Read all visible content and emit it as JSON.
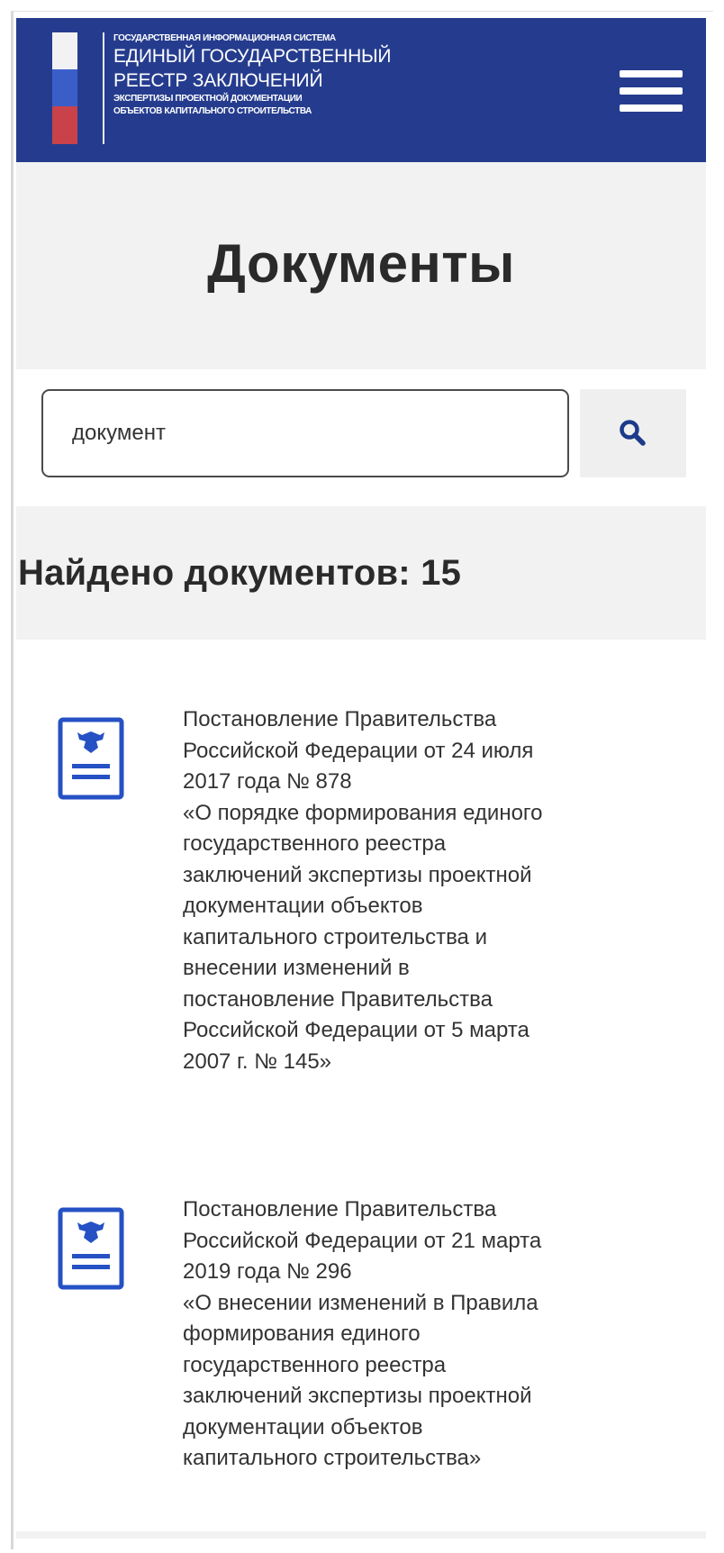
{
  "header": {
    "system_line": "ГОСУДАРСТВЕННАЯ ИНФОРМАЦИОННАЯ СИСТЕМА",
    "title_line_1": "ЕДИНЫЙ ГОСУДАРСТВЕННЫЙ",
    "title_line_2": "РЕЕСТР ЗАКЛЮЧЕНИЙ",
    "subtitle_line_1": "ЭКСПЕРТИЗЫ ПРОЕКТНОЙ ДОКУМЕНТАЦИИ",
    "subtitle_line_2": "ОБЪЕКТОВ КАПИТАЛЬНОГО СТРОИТЕЛЬСТВА",
    "background_color": "#253c8e",
    "menu_icon": "hamburger-menu-icon"
  },
  "page": {
    "title": "Документы"
  },
  "search": {
    "value": "документ",
    "button_icon": "search-icon"
  },
  "results": {
    "count_text": "Найдено документов: 15",
    "items": [
      {
        "title_lines": [
          "Постановление Правительства",
          "Российской Федерации от 24 июля",
          "2017 года № 878"
        ],
        "description_lines": [
          "«О порядке формирования единого",
          "государственного реестра",
          "заключений экспертизы проектной",
          "документации объектов",
          "капитального строительства и",
          "внесении изменений в",
          "постановление Правительства",
          "Российской Федерации от 5 марта",
          "2007 г. № 145»"
        ],
        "icon": "document-icon"
      },
      {
        "title_lines": [
          "Постановление Правительства",
          "Российской Федерации от 21 марта",
          "2019 года № 296"
        ],
        "description_lines": [
          "«О внесении изменений в Правила",
          "формирования единого",
          "государственного реестра",
          "заключений экспертизы проектной",
          "документации объектов",
          "капитального строительства»"
        ],
        "icon": "document-icon"
      }
    ]
  }
}
